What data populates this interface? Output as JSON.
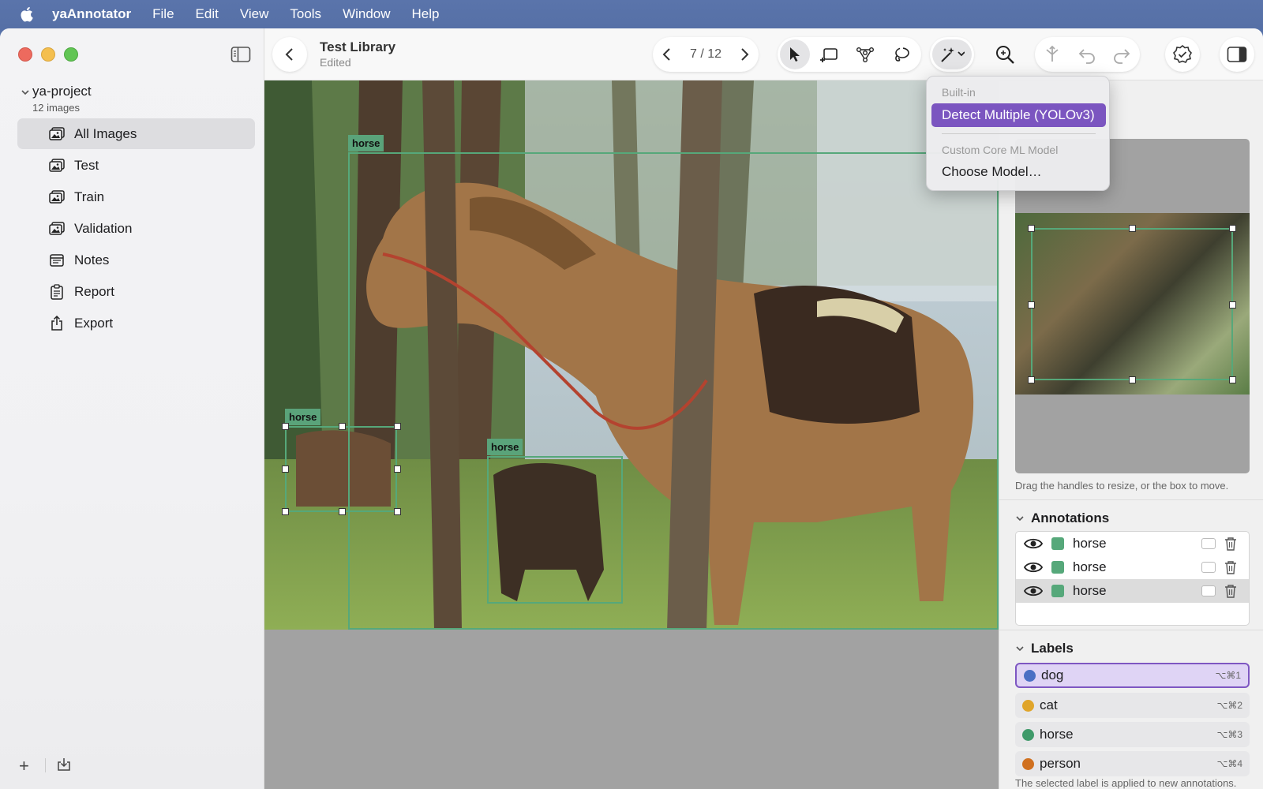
{
  "menubar": {
    "app_name": "yaAnnotator",
    "items": [
      "File",
      "Edit",
      "View",
      "Tools",
      "Window",
      "Help"
    ]
  },
  "sidebar": {
    "project_name": "ya-project",
    "project_count": "12 images",
    "items": [
      {
        "label": "All Images",
        "icon": "images-icon",
        "active": true
      },
      {
        "label": "Test",
        "icon": "images-icon"
      },
      {
        "label": "Train",
        "icon": "images-icon"
      },
      {
        "label": "Validation",
        "icon": "images-icon"
      },
      {
        "label": "Notes",
        "icon": "notes-icon"
      },
      {
        "label": "Report",
        "icon": "report-icon"
      },
      {
        "label": "Export",
        "icon": "export-icon"
      }
    ],
    "add_label": "+"
  },
  "toolbar": {
    "title": "Test Library",
    "subtitle": "Edited",
    "page_counter": "7 / 12"
  },
  "canvas": {
    "boxes": [
      {
        "label": "horse"
      },
      {
        "label": "horse"
      },
      {
        "label": "horse"
      }
    ],
    "box_color": "#56a87a"
  },
  "dropdown": {
    "header_builtin": "Built-in",
    "item_detect": "Detect Multiple (YOLOv3)",
    "header_custom": "Custom Core ML Model",
    "item_choose": "Choose Model…",
    "highlight_color": "#7b55c0"
  },
  "inspector": {
    "hint": "Drag the handles to resize, or the box to move.",
    "annotations_title": "Annotations",
    "annotations": [
      {
        "label": "horse",
        "color": "#56a87a"
      },
      {
        "label": "horse",
        "color": "#56a87a"
      },
      {
        "label": "horse",
        "color": "#56a87a",
        "selected": true
      }
    ],
    "labels_title": "Labels",
    "labels": [
      {
        "name": "dog",
        "shortcut": "⌥⌘1",
        "color": "#4a6fc4",
        "active": true
      },
      {
        "name": "cat",
        "shortcut": "⌥⌘2",
        "color": "#e0a52a"
      },
      {
        "name": "horse",
        "shortcut": "⌥⌘3",
        "color": "#3f9a6a"
      },
      {
        "name": "person",
        "shortcut": "⌥⌘4",
        "color": "#d0701f"
      }
    ],
    "labels_hint": "The selected label is applied to new annotations."
  }
}
